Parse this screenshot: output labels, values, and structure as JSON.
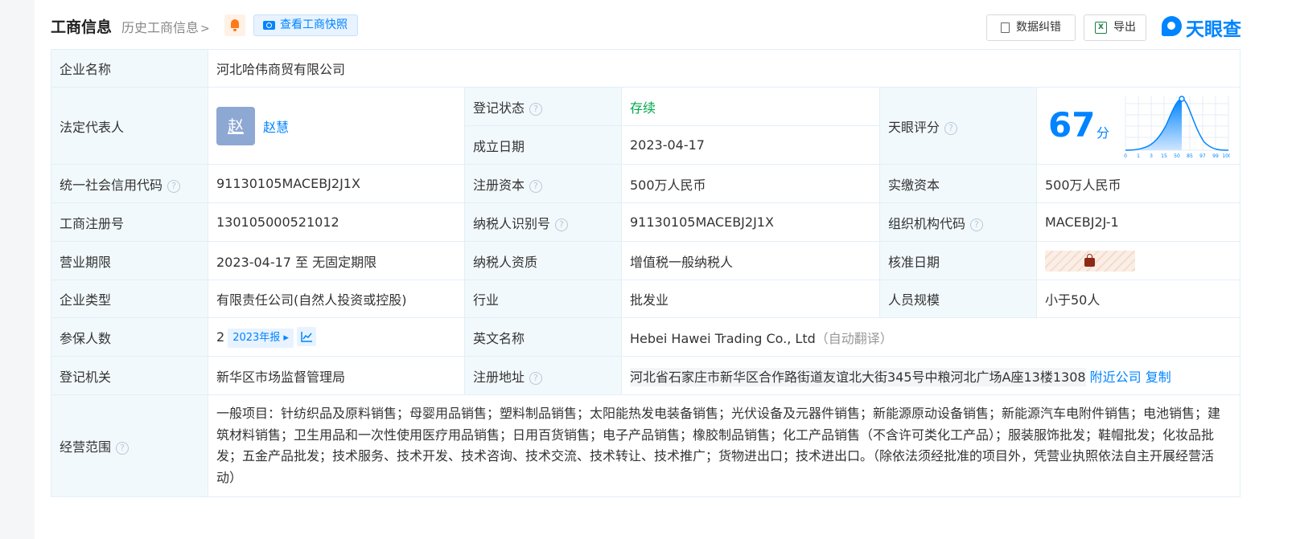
{
  "header": {
    "title": "工商信息",
    "history": "历史工商信息",
    "history_chevron": ">",
    "snapshot_button": "查看工商快照",
    "correct_button": "数据纠错",
    "export_button": "导出",
    "export_icon_text": "X",
    "logo_text": "天眼查"
  },
  "icons": [
    "bell-icon",
    "camera-icon",
    "document-icon",
    "excel-icon",
    "help-icon",
    "lock-icon",
    "trend-chart-icon"
  ],
  "colors": {
    "accent": "#0084ff",
    "status_green": "#00a84a",
    "label_bg": "#f2f9fc"
  },
  "company": {
    "name_label": "企业名称",
    "name": "河北哈伟商贸有限公司",
    "legal_rep_label": "法定代表人",
    "legal_rep_avatar": "赵",
    "legal_rep": "赵慧",
    "reg_status_label": "登记状态",
    "reg_status": "存续",
    "est_date_label": "成立日期",
    "est_date": "2023-04-17",
    "score_label": "天眼评分",
    "score": "67",
    "score_unit": "分",
    "score_ticks": [
      "0",
      "1",
      "3",
      "15",
      "50",
      "85",
      "97",
      "99",
      "100"
    ],
    "credit_code_label": "统一社会信用代码",
    "credit_code": "91130105MACEBJ2J1X",
    "reg_capital_label": "注册资本",
    "reg_capital": "500万人民币",
    "paid_capital_label": "实缴资本",
    "paid_capital": "500万人民币",
    "biz_reg_no_label": "工商注册号",
    "biz_reg_no": "130105000521012",
    "taxpayer_id_label": "纳税人识别号",
    "taxpayer_id": "91130105MACEBJ2J1X",
    "org_code_label": "组织机构代码",
    "org_code": "MACEBJ2J-1",
    "term_label": "营业期限",
    "term": "2023-04-17 至 无固定期限",
    "taxpayer_qual_label": "纳税人资质",
    "taxpayer_qual": "增值税一般纳税人",
    "approval_date_label": "核准日期",
    "type_label": "企业类型",
    "type": "有限责任公司(自然人投资或控股)",
    "industry_label": "行业",
    "industry": "批发业",
    "staff_label": "人员规模",
    "staff": "小于50人",
    "insured_label": "参保人数",
    "insured": "2",
    "insured_report": "2023年报",
    "english_name_label": "英文名称",
    "english_name": "Hebei Hawei Trading Co., Ltd",
    "english_name_note": "（自动翻译）",
    "authority_label": "登记机关",
    "authority": "新华区市场监督管理局",
    "address_label": "注册地址",
    "address": "河北省石家庄市新华区合作路街道友谊北大街345号中粮河北广场A座13楼1308",
    "nearby_link": "附近公司",
    "copy_link": "复制",
    "scope_label": "经营范围",
    "scope": "一般项目：针纺织品及原料销售；母婴用品销售；塑料制品销售；太阳能热发电装备销售；光伏设备及元器件销售；新能源原动设备销售；新能源汽车电附件销售；电池销售；建筑材料销售；卫生用品和一次性使用医疗用品销售；日用百货销售；电子产品销售；橡胶制品销售；化工产品销售（不含许可类化工产品）；服装服饰批发；鞋帽批发；化妆品批发；五金产品批发；技术服务、技术开发、技术咨询、技术交流、技术转让、技术推广；货物进出口；技术进出口。（除依法须经批准的项目外，凭营业执照依法自主开展经营活动）"
  }
}
